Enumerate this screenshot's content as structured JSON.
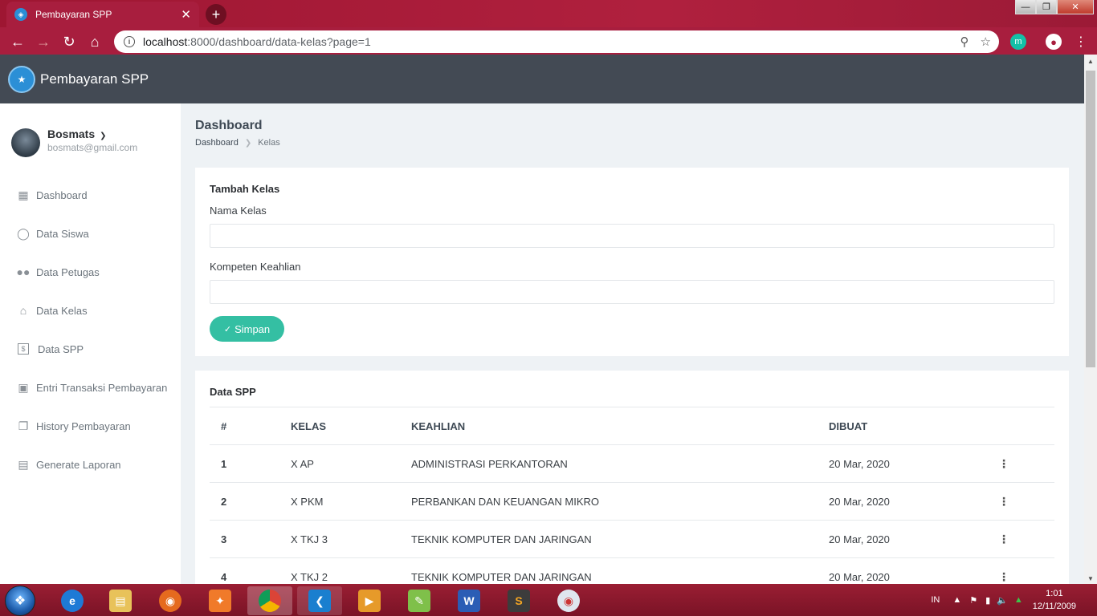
{
  "browser": {
    "tab_title": "Pembayaran SPP",
    "url_host": "localhost",
    "url_path": ":8000/dashboard/data-kelas?page=1",
    "extension_label": "m"
  },
  "app": {
    "brand": "Pembayaran SPP",
    "user": {
      "name": "Bosmats",
      "email": "bosmats@gmail.com"
    },
    "menu": [
      {
        "label": "Dashboard",
        "icon": "dashboard-icon"
      },
      {
        "label": "Data Siswa",
        "icon": "person-icon"
      },
      {
        "label": "Data Petugas",
        "icon": "people-icon"
      },
      {
        "label": "Data Kelas",
        "icon": "home-icon"
      },
      {
        "label": "Data SPP",
        "icon": "money-icon"
      },
      {
        "label": "Entri Transaksi Pembayaran",
        "icon": "cash-icon"
      },
      {
        "label": "History Pembayaran",
        "icon": "files-icon"
      },
      {
        "label": "Generate Laporan",
        "icon": "document-icon"
      }
    ]
  },
  "page": {
    "title": "Dashboard",
    "breadcrumb": [
      "Dashboard",
      "Kelas"
    ]
  },
  "form": {
    "title": "Tambah Kelas",
    "field1_label": "Nama Kelas",
    "field1_value": "",
    "field2_label": "Kompeten Keahlian",
    "field2_value": "",
    "submit_label": "Simpan"
  },
  "table": {
    "title": "Data SPP",
    "headers": [
      "#",
      "KELAS",
      "KEAHLIAN",
      "DIBUAT"
    ],
    "rows": [
      {
        "no": "1",
        "kelas": "X AP",
        "keahlian": "ADMINISTRASI PERKANTORAN",
        "dibuat": "20 Mar, 2020"
      },
      {
        "no": "2",
        "kelas": "X PKM",
        "keahlian": "PERBANKAN DAN KEUANGAN MIKRO",
        "dibuat": "20 Mar, 2020"
      },
      {
        "no": "3",
        "kelas": "X TKJ 3",
        "keahlian": "TEKNIK KOMPUTER DAN JARINGAN",
        "dibuat": "20 Mar, 2020"
      },
      {
        "no": "4",
        "kelas": "X TKJ 2",
        "keahlian": "TEKNIK KOMPUTER DAN JARINGAN",
        "dibuat": "20 Mar, 2020"
      }
    ]
  },
  "taskbar": {
    "language": "IN",
    "time": "1:01",
    "date": "12/11/2009"
  },
  "colors": {
    "accent": "#34bfa3",
    "topbar": "#434a54",
    "browser_frame": "#a81e3e"
  }
}
